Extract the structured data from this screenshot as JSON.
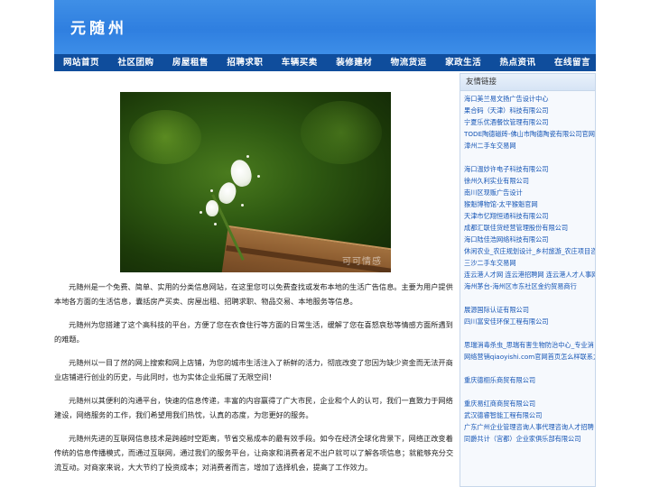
{
  "site": {
    "title": "元随州"
  },
  "nav": {
    "items": [
      {
        "label": "网站首页"
      },
      {
        "label": "社区团购"
      },
      {
        "label": "房屋租售"
      },
      {
        "label": "招聘求职"
      },
      {
        "label": "车辆买卖"
      },
      {
        "label": "装修建材"
      },
      {
        "label": "物流货运"
      },
      {
        "label": "家政生活"
      },
      {
        "label": "热点资讯"
      },
      {
        "label": "在线留言"
      }
    ]
  },
  "photo": {
    "watermark": "可可情感"
  },
  "article": {
    "paragraphs": [
      "元随州是一个免费、简单、实用的分类信息网站，在这里您可以免费查找或发布本地的生活广告信息。主要为用户提供本地各方面的生活信息，囊括房产买卖、房屋出租、招聘求职、物品交易、本地服务等信息。",
      "元随州为您搭建了这个高科技的平台，方便了您在衣食住行等方面的日常生活，缓解了您在喜怒哀愁等情感方面所遇到的难题。",
      "元随州以一目了然的网上搜索和网上店铺，为您的城市生活注入了新鲜的活力，彻底改变了您因为缺少资金而无法开商业店铺进行创业的历史，与此同时，也为实体企业拓展了无限空间！",
      "元随州以其便利的沟通平台，快速的信息传递，丰富的内容赢得了广大市民，企业和个人的认可，我们一直致力于网络建设，网络服务的工作，我们希望用我们热忱，认真的态度，为您更好的服务。",
      "元随州先进的互联网信息技术是跨越时空距离，节省交易成本的最有效手段。如今在经济全球化背景下，网络正改变着传统的信息传播模式，而通过互联网，通过我们的服务平台，让商家和消费者足不出户就可以了解各项信息；就能够充分交流互动。对商家来说，大大节约了投资成本；对消费者而言，增加了选择机会，提高了工作效力。"
    ]
  },
  "sidebar": {
    "title": "友情链接",
    "links": [
      "海口美兰易文扬广告设计中心",
      "果合码（天津）科技有限公司",
      "宁夏乐优酒餐饮管理有限公司",
      "TODE陶德磁砖-佛山市陶德陶瓷有限公司官网",
      "漳州二手车交易网",
      "",
      "海口温妙许电子科技有限公司",
      "徐州久利实业有限公司",
      "南川区现贩广告设计",
      "猴魁博物馆-太平猴魁官网",
      "天津市忆翔恒通科技有限公司",
      "成都汇联佳货经营管理股份有限公司",
      "海口陆佳浩网络科技有限公司",
      "休闲农业_农庄规划设计_乡村旅游_农庄项目咨",
      "三沙二手车交易网",
      "连云港人才网 连云港招聘网 连云港人才人事网",
      "海州茅台-海州区市东社区金约贸易商行",
      "",
      "展源国际认证有限公司",
      "四川富安佳环保工程有限公司",
      "",
      "思瑞消毒杀虫_思瑞有害生物防治中心_专业消",
      "网络营销qiaoyishi.com官网首页怎么样联系方式",
      "",
      "重庆德栩乐商贸有限公司",
      "",
      "重庆易红商商贸有限公司",
      "武汉德睿智能工程有限公司",
      "广东广州企业管理咨询人事代理咨询人才招聘",
      "同爵共计（宫都）企业家俱乐部有限公司"
    ]
  }
}
